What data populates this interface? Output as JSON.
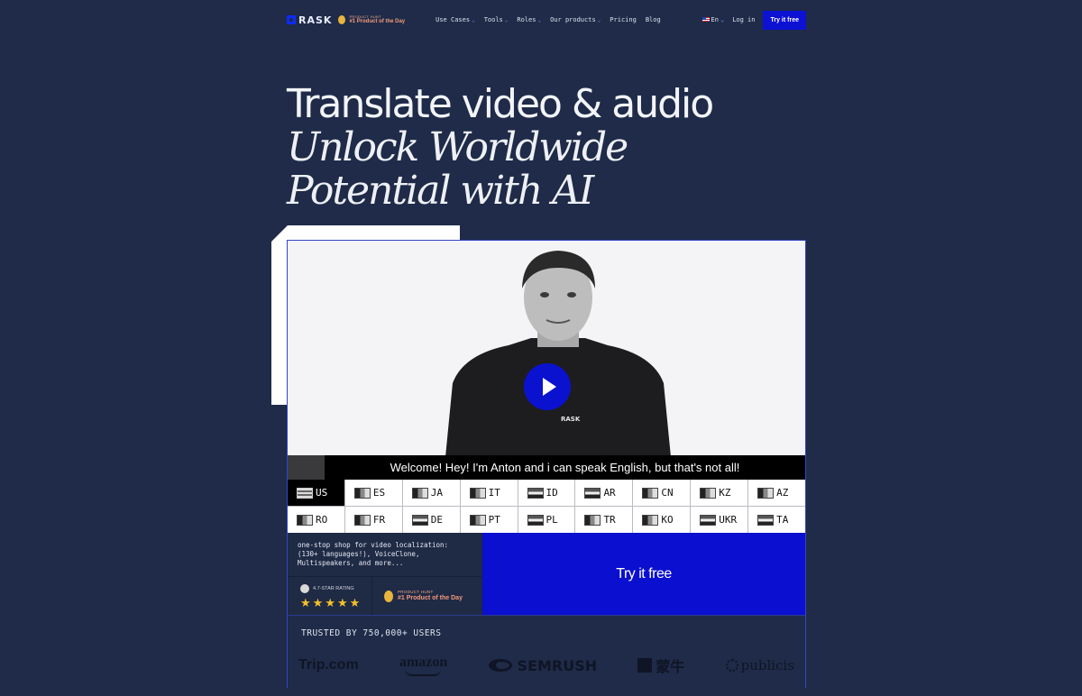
{
  "header": {
    "logo": "RASK",
    "product_hunt_small": "PRODUCT HUNT",
    "product_hunt_title": "#1 Product of the Day",
    "menu": [
      {
        "label": "Use Cases",
        "has_dropdown": true
      },
      {
        "label": "Tools",
        "has_dropdown": true
      },
      {
        "label": "Roles",
        "has_dropdown": true
      },
      {
        "label": "Our products",
        "has_dropdown": true
      },
      {
        "label": "Pricing",
        "has_dropdown": false
      },
      {
        "label": "Blog",
        "has_dropdown": false
      }
    ],
    "language": "En",
    "login": "Log in",
    "cta": "Try it free"
  },
  "hero": {
    "line1": "Translate video & audio",
    "line2": "Unlock Worldwide",
    "line3": "Potential with AI"
  },
  "video": {
    "shirt_logo": "RASK",
    "caption": "Welcome! Hey! I'm Anton and i can speak English, but that's not all!"
  },
  "languages": [
    {
      "code": "US",
      "active": true
    },
    {
      "code": "ES"
    },
    {
      "code": "JA"
    },
    {
      "code": "IT"
    },
    {
      "code": "ID"
    },
    {
      "code": "AR"
    },
    {
      "code": "CN"
    },
    {
      "code": "KZ"
    },
    {
      "code": "AZ"
    },
    {
      "code": "RO"
    },
    {
      "code": "FR"
    },
    {
      "code": "DE"
    },
    {
      "code": "PT"
    },
    {
      "code": "PL"
    },
    {
      "code": "TR"
    },
    {
      "code": "KO"
    },
    {
      "code": "UKR"
    },
    {
      "code": "TA"
    }
  ],
  "info": {
    "text_lines": [
      "one-stop shop for video localization:",
      "(130+ languages!), VoiceClone,",
      "Multispeakers, and more..."
    ],
    "rating_label": "4.7-STAR RATING",
    "stars": 5,
    "product_hunt_small": "PRODUCT HUNT",
    "product_hunt_title": "#1 Product of the Day"
  },
  "try_free": "Try it free",
  "trusted": {
    "title": "TRUSTED BY 750,000+ USERS",
    "logos": [
      "Trip.com",
      "amazon",
      "SEMRUSH",
      "蒙牛",
      "publicis"
    ]
  },
  "colors": {
    "background": "#1f2b48",
    "accent_blue": "#0b0fd0",
    "star": "#f3c12a"
  }
}
